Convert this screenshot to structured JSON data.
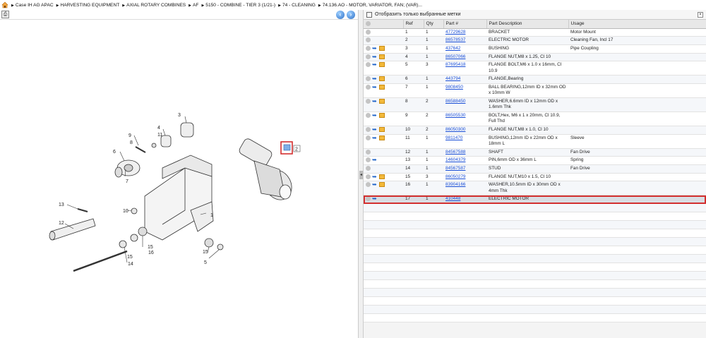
{
  "breadcrumb": [
    "Case IH AG APAC",
    "HARVESTING EQUIPMENT",
    "AXIAL ROTARY COMBINES",
    "AF",
    "5150 - COMBINE - TIER 3 (1/21-)",
    "74 - CLEANING",
    "74.136.AO - MOTOR, VARIATOR, FAN; (VAR)..."
  ],
  "filter": {
    "label": "Отобразить только выбранные метки"
  },
  "callout_selected": "2",
  "diagram_labels": [
    "3",
    "4",
    "11",
    "9",
    "8",
    "6",
    "7",
    "13",
    "12",
    "10",
    "15",
    "16",
    "15",
    "14",
    "1",
    "15",
    "5"
  ],
  "table": {
    "columns": [
      "Ref",
      "Qty",
      "Part #",
      "Part Description",
      "Usage"
    ],
    "rows": [
      {
        "ref": "1",
        "qty": "1",
        "part": "47729628",
        "desc": "BRACKET",
        "usage": "Motor Mount",
        "icons": [
          "grey"
        ]
      },
      {
        "ref": "2",
        "qty": "1",
        "part": "86578537",
        "desc": "ELECTRIC MOTOR",
        "usage": "Cleaning Fan, Incl 17",
        "icons": [
          "grey"
        ]
      },
      {
        "ref": "3",
        "qty": "1",
        "part": "437642",
        "desc": "BUSHING",
        "usage": "Pipe Coupling",
        "icons": [
          "grey",
          "blue",
          "box"
        ]
      },
      {
        "ref": "4",
        "qty": "1",
        "part": "86507066",
        "desc": "FLANGE NUT,M8 x 1.25, Cl 10",
        "usage": "",
        "icons": [
          "grey",
          "blue",
          "box"
        ]
      },
      {
        "ref": "5",
        "qty": "3",
        "part": "87695418",
        "desc": "FLANGE BOLT,M6 x 1.0 x 16mm, Cl 10.9",
        "usage": "",
        "icons": [
          "grey",
          "blue",
          "box"
        ]
      },
      {
        "ref": "6",
        "qty": "1",
        "part": "443794",
        "desc": "FLANGE,Bearing",
        "usage": "",
        "icons": [
          "grey",
          "blue",
          "box"
        ]
      },
      {
        "ref": "7",
        "qty": "1",
        "part": "9808450",
        "desc": "BALL BEARING,12mm ID x 32mm OD x 10mm W",
        "usage": "",
        "icons": [
          "grey",
          "blue",
          "box"
        ]
      },
      {
        "ref": "8",
        "qty": "2",
        "part": "86588450",
        "desc": "WASHER,6.6mm ID x 12mm OD x 1.6mm Thk",
        "usage": "",
        "icons": [
          "grey",
          "blue",
          "box"
        ]
      },
      {
        "ref": "9",
        "qty": "2",
        "part": "86505530",
        "desc": "BOLT,Hex, M6 x 1 x 20mm, Cl 10.9, Full Thd",
        "usage": "",
        "icons": [
          "grey",
          "blue",
          "box"
        ]
      },
      {
        "ref": "10",
        "qty": "2",
        "part": "86050300",
        "desc": "FLANGE NUT,M8 x 1.0, Cl 10",
        "usage": "",
        "icons": [
          "grey",
          "blue",
          "box"
        ]
      },
      {
        "ref": "11",
        "qty": "1",
        "part": "9811470",
        "desc": "BUSHING,12mm ID x 22mm OD x 18mm L",
        "usage": "Sleeve",
        "icons": [
          "grey",
          "blue",
          "box"
        ]
      },
      {
        "ref": "12",
        "qty": "1",
        "part": "84567588",
        "desc": "SHAFT",
        "usage": "Fan Drive",
        "icons": [
          "grey"
        ]
      },
      {
        "ref": "13",
        "qty": "1",
        "part": "14604379",
        "desc": "PIN,6mm OD x 36mm L",
        "usage": "Spring",
        "icons": [
          "grey",
          "blue"
        ]
      },
      {
        "ref": "14",
        "qty": "1",
        "part": "84567587",
        "desc": "STUD",
        "usage": "Fan Drive",
        "icons": [
          "grey"
        ]
      },
      {
        "ref": "15",
        "qty": "3",
        "part": "86050279",
        "desc": "FLANGE NUT,M10 x 1.5, Cl 10",
        "usage": "",
        "icons": [
          "grey",
          "blue",
          "box"
        ]
      },
      {
        "ref": "16",
        "qty": "1",
        "part": "83904166",
        "desc": "WASHER,10.5mm ID x 30mm OD x 4mm Thk",
        "usage": "",
        "icons": [
          "grey",
          "blue",
          "box"
        ]
      },
      {
        "ref": "17",
        "qty": "1",
        "part": "410448",
        "desc": "ELECTRIC MOTOR",
        "usage": "",
        "icons": [
          "grey",
          "blue"
        ],
        "selected": true
      }
    ]
  },
  "colors": {
    "selection_outline": "#d32f2f",
    "link": "#1a4fd6",
    "nav_button": "#2f72c9"
  }
}
